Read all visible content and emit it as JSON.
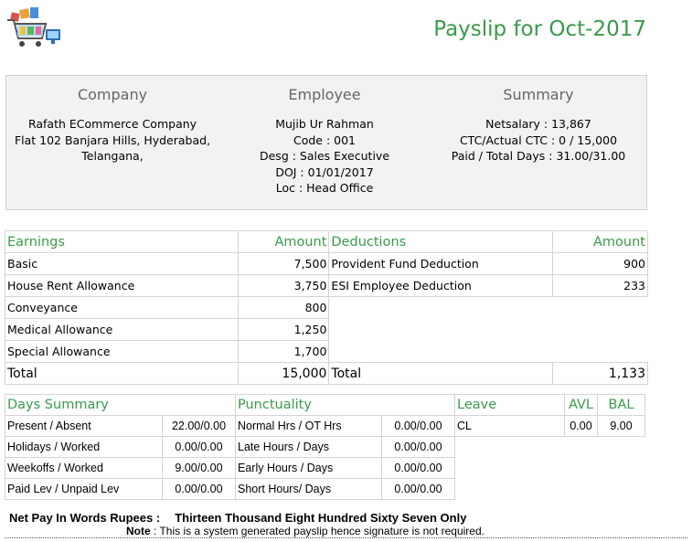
{
  "title": "Payslip for Oct-2017",
  "company": {
    "heading": "Company",
    "name": "Rafath ECommerce Company",
    "address1": "Flat 102 Banjara Hills, Hyderabad,",
    "address2": "Telangana,"
  },
  "employee": {
    "heading": "Employee",
    "name": "Mujib Ur Rahman",
    "code": "Code : 001",
    "desg": "Desg : Sales Executive",
    "doj": "DOJ : 01/01/2017",
    "loc": "Loc : Head Office"
  },
  "summary": {
    "heading": "Summary",
    "netsalary": "Netsalary : 13,867",
    "ctc": "CTC/Actual CTC : 0 / 15,000",
    "days": "Paid / Total Days : 31.00/31.00"
  },
  "earnings": {
    "heading": "Earnings",
    "amount_heading": "Amount",
    "rows": [
      {
        "label": "Basic",
        "amount": "7,500"
      },
      {
        "label": "House Rent Allowance",
        "amount": "3,750"
      },
      {
        "label": "Conveyance",
        "amount": "800"
      },
      {
        "label": "Medical Allowance",
        "amount": "1,250"
      },
      {
        "label": "Special Allowance",
        "amount": "1,700"
      }
    ],
    "total_label": "Total",
    "total": "15,000"
  },
  "deductions": {
    "heading": "Deductions",
    "amount_heading": "Amount",
    "rows": [
      {
        "label": "Provident Fund Deduction",
        "amount": "900"
      },
      {
        "label": "ESI Employee Deduction",
        "amount": "233"
      }
    ],
    "total_label": "Total",
    "total": "1,133"
  },
  "days_summary": {
    "heading": "Days Summary",
    "rows": [
      {
        "label": "Present / Absent",
        "value": "22.00/0.00"
      },
      {
        "label": "Holidays / Worked",
        "value": "0.00/0.00"
      },
      {
        "label": "Weekoffs / Worked",
        "value": "9.00/0.00"
      },
      {
        "label": "Paid Lev / Unpaid Lev",
        "value": "0.00/0.00"
      }
    ]
  },
  "punctuality": {
    "heading": "Punctuality",
    "rows": [
      {
        "label": "Normal Hrs / OT Hrs",
        "value": "0.00/0.00"
      },
      {
        "label": "Late Hours / Days",
        "value": "0.00/0.00"
      },
      {
        "label": "Early Hours / Days",
        "value": "0.00/0.00"
      },
      {
        "label": "Short Hours/ Days",
        "value": "0.00/0.00"
      }
    ]
  },
  "leave": {
    "heading": "Leave",
    "avl_heading": "AVL",
    "bal_heading": "BAL",
    "rows": [
      {
        "type": "CL",
        "avl": "0.00",
        "bal": "9.00"
      }
    ]
  },
  "net_pay": {
    "label": "Net Pay In Words Rupees :",
    "words": "Thirteen Thousand Eight Hundred Sixty Seven Only"
  },
  "note": {
    "label": "Note",
    "text": " : This is a system generated payslip hence signature is not required."
  },
  "colors": {
    "accent": "#3a9a4a",
    "header_bg": "#f2f2f2"
  }
}
